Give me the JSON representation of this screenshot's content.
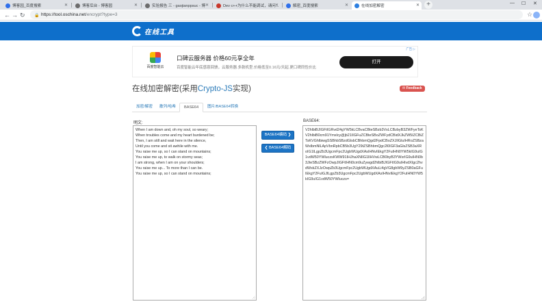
{
  "browser": {
    "tabs": [
      {
        "title": "博客园_百度搜索",
        "color": "#2f6fea"
      },
      {
        "title": "博客后台 - 博客园",
        "color": "#6c6c6c"
      },
      {
        "title": "实验报告 三 - gaojianppsuc - 博",
        "color": "#6c6c6c"
      },
      {
        "title": "Dev c++为什么不能调试，请问...",
        "color": "#c8382c"
      },
      {
        "title": "解密_百度搜索",
        "color": "#2f6fea"
      },
      {
        "title": "在线加密解密",
        "color": "#2d7fe0"
      }
    ],
    "url_scheme": "https://tool.oschina.net",
    "url_path": "/encrypt?type=3",
    "new_tab": "+",
    "minimize": "—",
    "maximize": "☐",
    "close": "✕"
  },
  "site": {
    "logo_text": "在线工具"
  },
  "ad": {
    "logo_caption": "百度智能云",
    "title": "口碑云服务器 价格60元享全年",
    "description": "百度智能云年底感恩回馈，云服务器.多款机型.价格低至0.16元/天起.更口碑同性价比",
    "button": "打开",
    "choice": "广告 ▷"
  },
  "page": {
    "title_prefix": "在线加密解密(采用",
    "title_highlight": "Crypto-JS",
    "title_suffix": "实现)",
    "feedback": "Feedback"
  },
  "tabs": [
    "加密/解密",
    "散列/哈希",
    "BASE64",
    "图片/BASE64转换"
  ],
  "input": {
    "label": "明文:",
    "lines": [
      "When I am down and, oh my soul, so weary;",
      "When troubles come and my heart burdened be;",
      "Then, I am still and wait here in the silence,",
      "Until you come and sit awhile with me.",
      "You raise me up, so I can stand on mountains;",
      "You raise me up, to walk on stormy seas;",
      "I am strong, when I am on your shoulders;",
      "You raise me up... To more than I can be.",
      "You raise me up, so I can stand on mountains;"
    ]
  },
  "buttons": {
    "encode": "BASE64编码 ❯",
    "decode": "❮ BASE64解码"
  },
  "output": {
    "label": "BASE64:",
    "text": "V2hlbiBJIGFtIGRvd24gYW5kLCBvaCBteSBzb3VsLCBzbyB3ZWFyeTsKV2hlbiB0cm91Ymxlcy@jb21IIGFuZCBteSBoZWFydCBidXJkZW5IZCBiZTsKVGhlbiwgSSBhbSBzdGlsbCBhbmQgd2FpdCBoZXJlIGluIHRoZSBzaWxlbmNlLApVbnRpbCB5b3UgY29tZSBhbmQgc2l0IGF3aGlsZSB3aXRoIG1lLgpZb3UgcmFpc2UgbWUgdXAsIHNvIEkgY2FuIHN0YW5kIG9uIG1vdW50YWluczsKWW91IHJhaXNlIG1lIHVwLCB0byB3YWxrIG9uIHN0b3JteSBzZWFzOwpJIGFtIHN0cm9uZywgd2hlbiBJIGFtIG9uIHlvdXIgc2hvdWxkZXJzOwpZb3UgcmFpc2UgbWUgdXAuLi4gVG8gbW9yZSB0aGFuIEkgY2FuIGJlLgpZb3UgcmFpc2UgbWUgdXAsIHNvIEkgY2FuIHN0YW5kIG9uIG1vdW50YWluczs="
  }
}
